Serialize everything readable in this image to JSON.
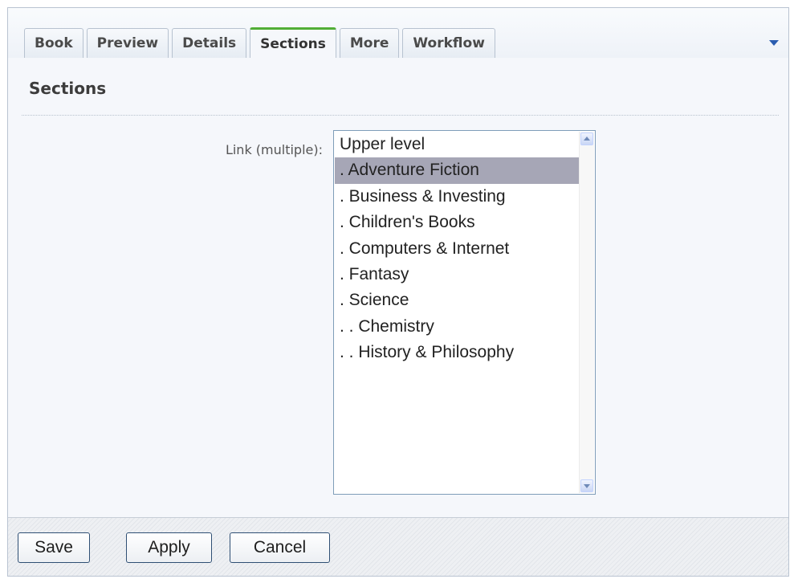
{
  "tabs": [
    {
      "label": "Book",
      "active": false
    },
    {
      "label": "Preview",
      "active": false
    },
    {
      "label": "Details",
      "active": false
    },
    {
      "label": "Sections",
      "active": true
    },
    {
      "label": "More",
      "active": false
    },
    {
      "label": "Workflow",
      "active": false
    }
  ],
  "tabs_menu_icon": "dropdown-arrow",
  "section": {
    "title": "Sections",
    "field_label": "Link (multiple):"
  },
  "listbox": {
    "items": [
      {
        "label": "Upper level",
        "selected": false
      },
      {
        "label": ". Adventure Fiction",
        "selected": true
      },
      {
        "label": ". Business & Investing",
        "selected": false
      },
      {
        "label": ". Children's Books",
        "selected": false
      },
      {
        "label": ". Computers & Internet",
        "selected": false
      },
      {
        "label": ". Fantasy",
        "selected": false
      },
      {
        "label": ". Science",
        "selected": false
      },
      {
        "label": ". . Chemistry",
        "selected": false
      },
      {
        "label": ". . History & Philosophy",
        "selected": false
      }
    ]
  },
  "footer": {
    "save_label": "Save",
    "apply_label": "Apply",
    "cancel_label": "Cancel"
  },
  "colors": {
    "active_tab_accent": "#51ae36",
    "selected_item_bg": "#a6a6b6",
    "menu_arrow": "#2a5db0"
  }
}
